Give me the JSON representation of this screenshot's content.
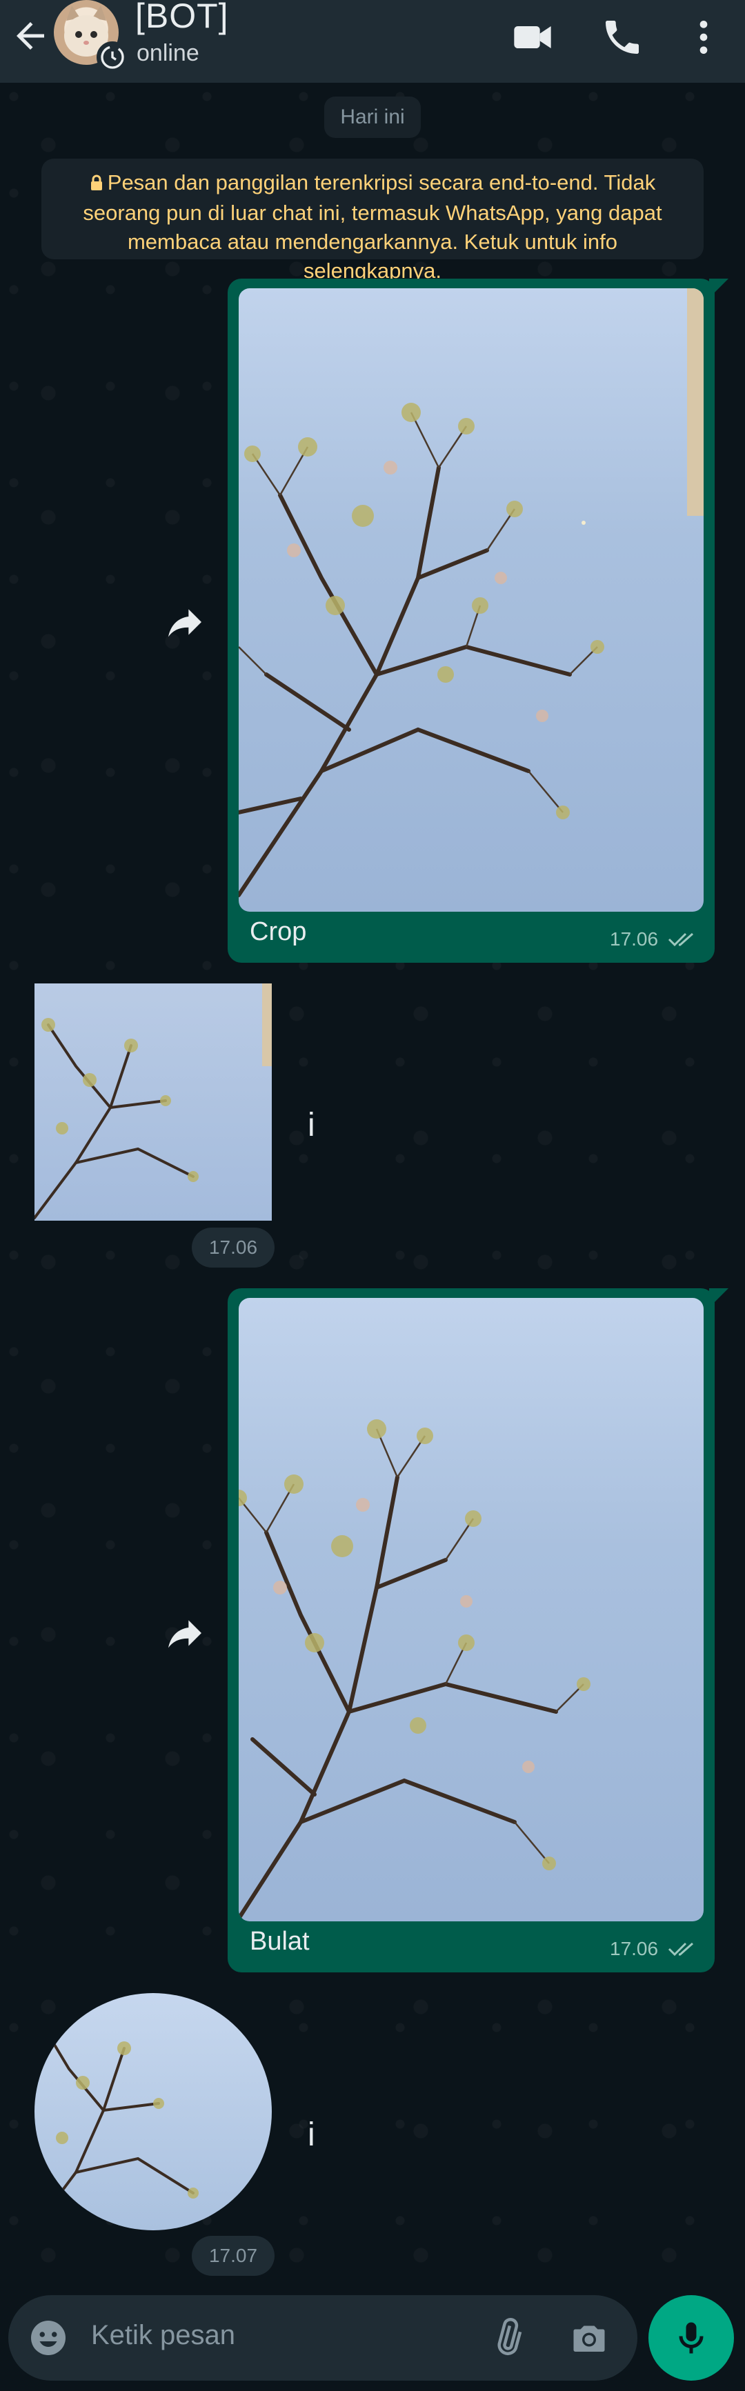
{
  "header": {
    "title": "[BOT]",
    "status": "online"
  },
  "chat": {
    "date_label": "Hari ini",
    "encryption_notice": "Pesan dan panggilan terenkripsi secara end-to-end. Tidak seorang pun di luar chat ini, termasuk WhatsApp, yang dapat membaca atau mendengarkannya. Ketuk untuk info selengkapnya.",
    "messages": [
      {
        "type": "image",
        "direction": "out",
        "caption": "Crop",
        "time": "17.06",
        "status": "read"
      },
      {
        "type": "sticker",
        "direction": "in",
        "shape": "square",
        "time": "17.06",
        "extra": "i"
      },
      {
        "type": "image",
        "direction": "out",
        "caption": "Bulat",
        "time": "17.06",
        "status": "read"
      },
      {
        "type": "sticker",
        "direction": "in",
        "shape": "circle",
        "time": "17.07",
        "extra": "i"
      }
    ]
  },
  "input": {
    "placeholder": "Ketik pesan"
  },
  "colors": {
    "background": "#0b141a",
    "header": "#1f2c34",
    "outgoing_bubble": "#005c4b",
    "accent": "#00a884",
    "notice_text": "#ffd279"
  },
  "icons": [
    "back-arrow-icon",
    "video-call-icon",
    "voice-call-icon",
    "more-options-icon",
    "forward-icon",
    "emoji-icon",
    "attach-icon",
    "camera-icon",
    "mic-icon",
    "lock-icon",
    "double-check-icon"
  ]
}
